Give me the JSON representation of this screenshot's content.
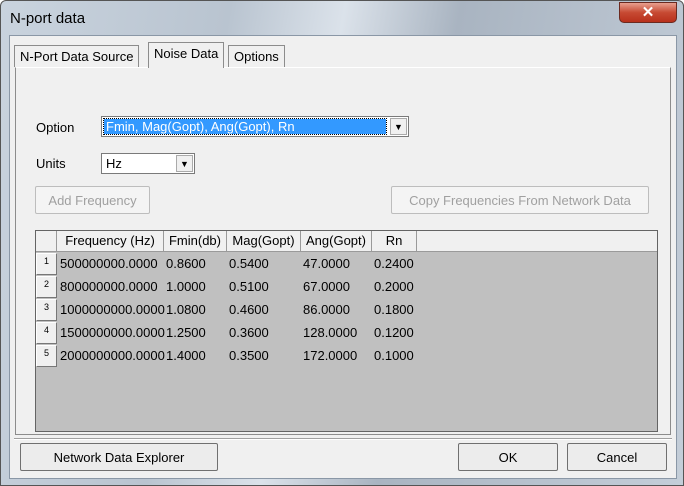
{
  "window": {
    "title": "N-port data",
    "close_icon": "close-icon"
  },
  "tabs": [
    {
      "label": "N-Port Data Source"
    },
    {
      "label": "Noise Data"
    },
    {
      "label": "Options"
    }
  ],
  "option": {
    "label": "Option",
    "value": "Fmin, Mag(Gopt), Ang(Gopt), Rn"
  },
  "units": {
    "label": "Units",
    "value": "Hz"
  },
  "buttons": {
    "add_frequency": "Add Frequency",
    "copy_frequencies": "Copy Frequencies From Network Data",
    "network_explorer": "Network Data Explorer",
    "ok": "OK",
    "cancel": "Cancel"
  },
  "table": {
    "columns": [
      "Frequency (Hz)",
      "Fmin(db)",
      "Mag(Gopt)",
      "Ang(Gopt)",
      "Rn"
    ],
    "rows": [
      {
        "n": "1",
        "cells": [
          "500000000.0000",
          "0.8600",
          "0.5400",
          "47.0000",
          "0.2400"
        ]
      },
      {
        "n": "2",
        "cells": [
          "800000000.0000",
          "1.0000",
          "0.5100",
          "67.0000",
          "0.2000"
        ]
      },
      {
        "n": "3",
        "cells": [
          "1000000000.0000",
          "1.0800",
          "0.4600",
          "86.0000",
          "0.1800"
        ]
      },
      {
        "n": "4",
        "cells": [
          "1500000000.0000",
          "1.2500",
          "0.3600",
          "128.0000",
          "0.1200"
        ]
      },
      {
        "n": "5",
        "cells": [
          "2000000000.0000",
          "1.4000",
          "0.3500",
          "172.0000",
          "0.1000"
        ]
      }
    ]
  }
}
